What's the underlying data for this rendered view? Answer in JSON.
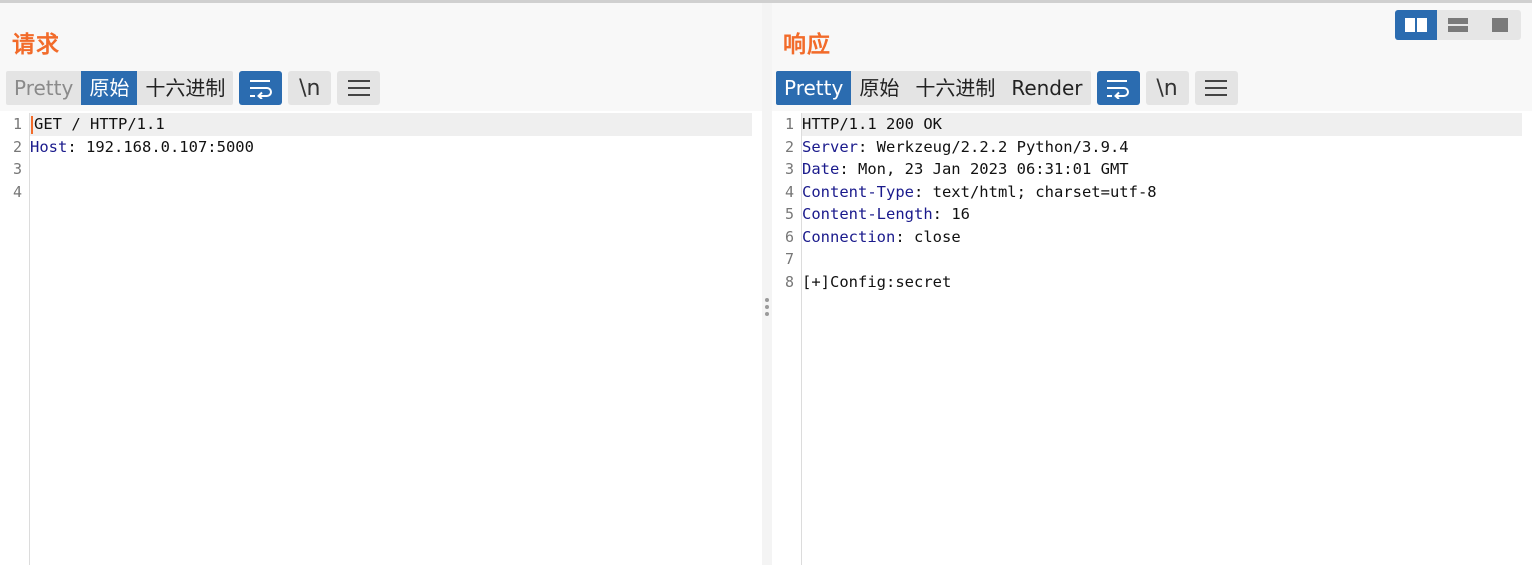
{
  "request": {
    "title": "请求",
    "tabs": [
      {
        "label": "Pretty",
        "state": "disabled"
      },
      {
        "label": "原始",
        "state": "active"
      },
      {
        "label": "十六进制",
        "state": "normal"
      }
    ],
    "newline_label": "\\n",
    "lines": [
      {
        "num": "1",
        "name": "",
        "rest": "GET / HTTP/1.1"
      },
      {
        "num": "2",
        "name": "Host",
        "rest": ": 192.168.0.107:5000"
      },
      {
        "num": "3",
        "name": "",
        "rest": ""
      },
      {
        "num": "4",
        "name": "",
        "rest": ""
      }
    ]
  },
  "response": {
    "title": "响应",
    "tabs": [
      {
        "label": "Pretty",
        "state": "active"
      },
      {
        "label": "原始",
        "state": "normal"
      },
      {
        "label": "十六进制",
        "state": "normal"
      },
      {
        "label": "Render",
        "state": "normal"
      }
    ],
    "newline_label": "\\n",
    "lines": [
      {
        "num": "1",
        "name": "",
        "rest": "HTTP/1.1 200 OK"
      },
      {
        "num": "2",
        "name": "Server",
        "rest": ": Werkzeug/2.2.2 Python/3.9.4"
      },
      {
        "num": "3",
        "name": "Date",
        "rest": ": Mon, 23 Jan 2023 06:31:01 GMT"
      },
      {
        "num": "4",
        "name": "Content-Type",
        "rest": ": text/html; charset=utf-8"
      },
      {
        "num": "5",
        "name": "Content-Length",
        "rest": ": 16"
      },
      {
        "num": "6",
        "name": "Connection",
        "rest": ": close"
      },
      {
        "num": "7",
        "name": "",
        "rest": ""
      },
      {
        "num": "8",
        "name": "",
        "rest": "[+]Config:secret"
      }
    ]
  },
  "colors": {
    "accent": "#f26b2a",
    "active_blue": "#2b6cb0",
    "header_name": "#1a1a8c"
  },
  "icons": {
    "wrap": "word-wrap-icon",
    "menu": "hamburger-menu-icon",
    "layout_side_by_side": "layout-columns-icon",
    "layout_stacked": "layout-rows-icon",
    "layout_single": "layout-single-icon"
  },
  "layout_mode": "side-by-side"
}
